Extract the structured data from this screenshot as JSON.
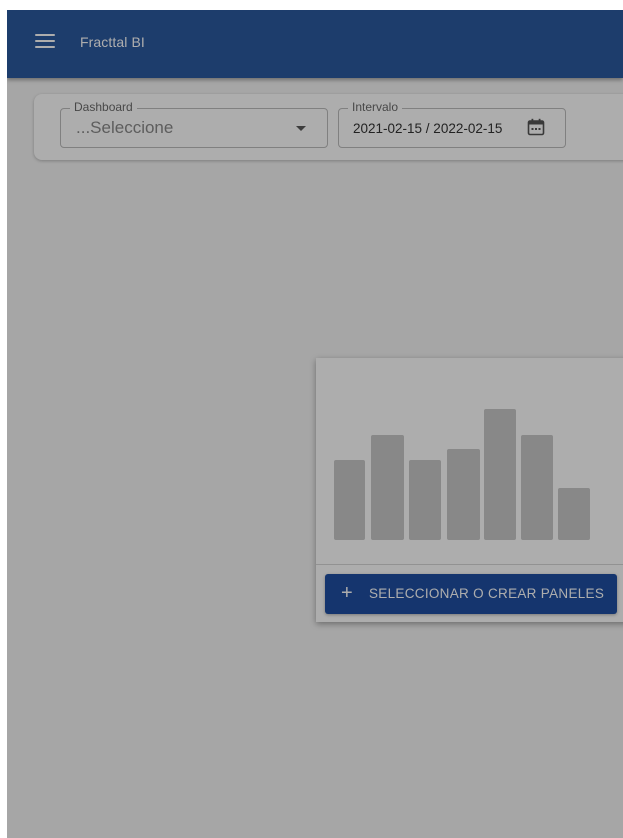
{
  "header": {
    "menu_icon": "hamburger-menu-icon",
    "title": "Fracttal BI"
  },
  "filters": {
    "dashboard": {
      "label": "Dashboard",
      "value": "...Seleccione"
    },
    "interval": {
      "label": "Intervalo",
      "value": "2021-02-15 / 2022-02-15",
      "icon": "calendar-icon"
    }
  },
  "empty_state": {
    "illustration": "bar-chart-placeholder",
    "button_icon": "plus-icon",
    "button_label": "SELECCIONAR O CREAR PANELES"
  },
  "colors": {
    "header": "#2c5aa0",
    "primary_button": "#1f4fa3",
    "placeholder_bars": "#c9c9c9"
  }
}
